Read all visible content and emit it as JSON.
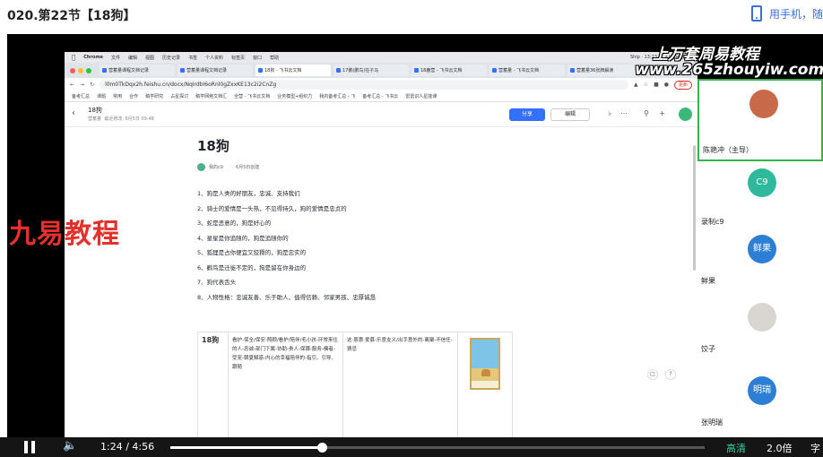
{
  "page": {
    "title": "020.第22节【18狗】",
    "mobile_link": "用手机，随"
  },
  "mac_menubar": {
    "items": [
      "Chrome",
      "文件",
      "编辑",
      "视图",
      "历史记录",
      "书签",
      "个人资料",
      "标签页",
      "窗口",
      "帮助"
    ],
    "status": "Ship · 13:23",
    "clock": "6月7日 周二"
  },
  "browser": {
    "tabs": [
      "营蓄量课程文档记录",
      "营蓄量课程文档记录",
      "18狗 - 飞书云文档",
      "17鹅(鹏鸟)在子马",
      "18鹿营 - 飞书云文档",
      "营蓄量 - 飞书云文档",
      "营蓄量36张牌解读"
    ],
    "url": "l0m0TkDqx2h.feishu.cn/docx/NqIrdbI6oRnl0gZxxKE13c2i2CnZg",
    "update_label": "更新",
    "bookmarks": [
      "备考汇总",
      "课题",
      "常用",
      "合作",
      "稿学研究",
      "占星探讨",
      "稿学网络文档汇",
      "全营 - 飞书云文档",
      "业务模型+组织力",
      "我的备考汇总 - 飞",
      "备考汇总 - 飞书云",
      "雷雷识人星能课"
    ]
  },
  "doc": {
    "name": "18狗",
    "meta_space": "营蓄量",
    "meta_date": "最近修改: 6月5日 09:48",
    "share_label": "分享",
    "edit_label": "编辑",
    "heading": "18狗",
    "author": "我的c9",
    "created": "6月5日创建",
    "items": [
      "1、狗是人类的好朋友，忠诚、支持我们",
      "2、骑士的爱情是一头热，不见得持久，狗的爱情是忠贞的",
      "3、蛇是恶意的，狗是好心的",
      "4、星星是你追随的，狗是追随你的",
      "5、狐狸是占你便宜又狡猾的，狗是忠实的",
      "6、鹳鸟是迁徙不定的，狗是留在你身边的",
      "7、狗代表舌头",
      "8、人物性格：忠诚友善、乐于助人、值得信赖、邻家男孩、忠厚诚恳"
    ],
    "table": {
      "name": "18狗",
      "col2": "看护-保全/保安-照顾/看护/陪伴/毛小孩-环常来往的人-忠诚-部门下属-协助-贵人-保镖-服务-模者-受宠-朝夏解惑-内心的幸福陪伴的-指引、引导、跟随",
      "col3": "这·恩惠·爱慕-乐意支义/出手意外的-离聚-不信任-猜忌"
    }
  },
  "watermarks": {
    "logo": "九易教程",
    "site_line1": "上万套周易教程",
    "site_line2": "www.265zhouyiw.com"
  },
  "participants": [
    {
      "name": "陈艳冲（主导）",
      "avatar": "",
      "color": "#c86a4a"
    },
    {
      "name": "录制c9",
      "avatar": "C9",
      "color": "#2fb99c"
    },
    {
      "name": "鲜果",
      "avatar": "鲜果",
      "color": "#2d7fd6"
    },
    {
      "name": "饺子",
      "avatar": "",
      "color": "#d9d6d2"
    },
    {
      "name": "张明瑞",
      "avatar": "明瑞",
      "color": "#2d7fd6"
    }
  ],
  "player": {
    "time_current": "1:24",
    "time_separator": "/",
    "time_total": "4:56",
    "progress": 0.2838,
    "quality": "高清",
    "speed": "2.0倍",
    "subtitle": "字"
  }
}
